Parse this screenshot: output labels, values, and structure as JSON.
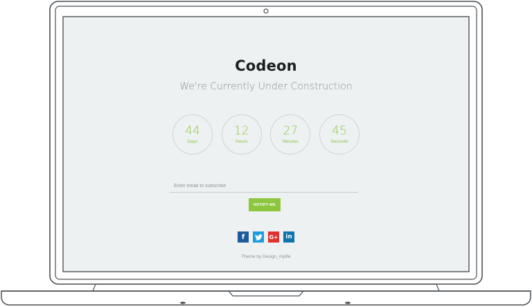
{
  "brand": "Codeon",
  "subtitle": "We're Currently Under Construction",
  "countdown": [
    {
      "value": "44",
      "unit": "Days"
    },
    {
      "value": "12",
      "unit": "Hours"
    },
    {
      "value": "27",
      "unit": "Minutes"
    },
    {
      "value": "45",
      "unit": "Seconds"
    }
  ],
  "subscribe": {
    "placeholder": "Enter email to subscribe",
    "button_label": "NOTIFY ME"
  },
  "social": [
    {
      "name": "facebook-icon",
      "glyph": "f"
    },
    {
      "name": "twitter-icon",
      "glyph": ""
    },
    {
      "name": "google-plus-icon",
      "glyph": "G+"
    },
    {
      "name": "linkedin-icon",
      "glyph": "in"
    }
  ],
  "footer": "Theme by Design_mylife",
  "colors": {
    "accent": "#8dc63f",
    "screen_bg": "#eef1f2",
    "facebook": "#1f5a9c",
    "twitter": "#1c9cde",
    "google_plus": "#e0302f",
    "linkedin": "#0d73ad"
  }
}
